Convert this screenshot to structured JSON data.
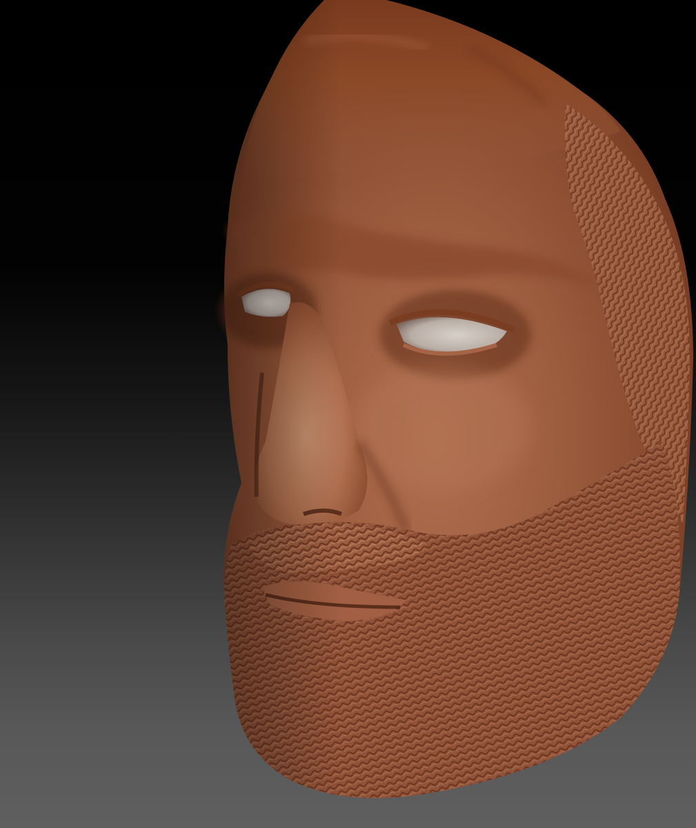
{
  "scene": {
    "subject": "sculpted-bearded-head",
    "colors": {
      "background_top": "#000000",
      "background_bottom": "#5f5f5f",
      "clay_dark": "#5a2a14",
      "clay_mid": "#8a4a2c",
      "clay_light": "#a9674a",
      "clay_highlight": "#c18766",
      "eye_white": "#c9c0b8",
      "beard_shadow": "#6a3520"
    }
  }
}
